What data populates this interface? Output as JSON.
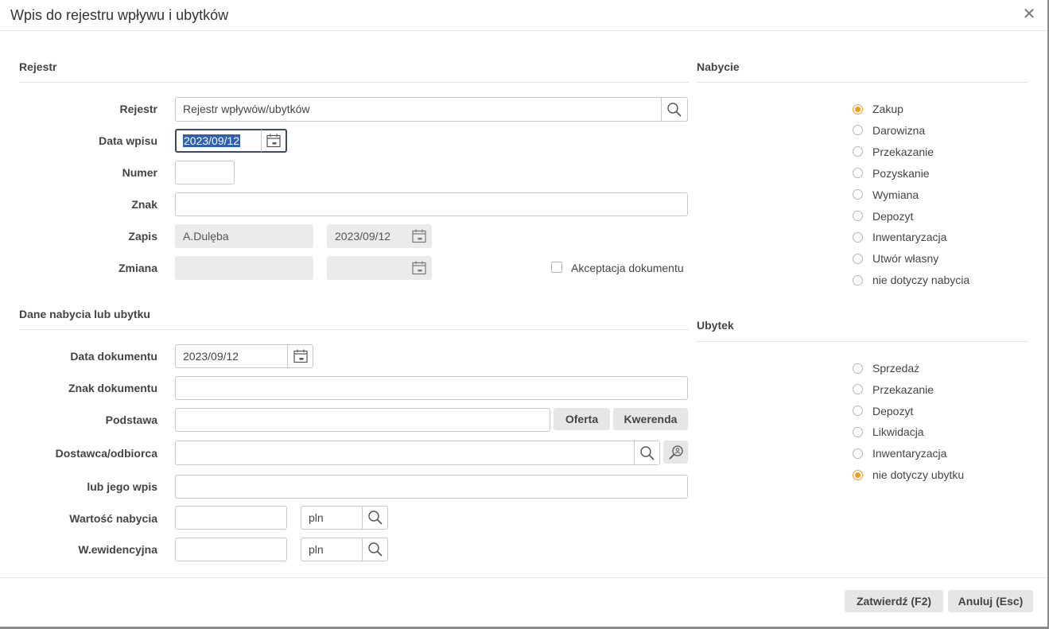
{
  "window": {
    "title": "Wpis do rejestru wpływu i ubytków"
  },
  "rejestr_section": {
    "title": "Rejestr",
    "rejestr_label": "Rejestr",
    "rejestr_value": "Rejestr wpływów/ubytków",
    "data_wpisu_label": "Data wpisu",
    "data_wpisu_value": "2023/09/12",
    "numer_label": "Numer",
    "numer_value": "",
    "znak_label": "Znak",
    "znak_value": "",
    "zapis_label": "Zapis",
    "zapis_user": "A.Dulęba",
    "zapis_date": "2023/09/12",
    "zmiana_label": "Zmiana",
    "zmiana_user": "",
    "zmiana_date": "",
    "akceptacja_label": "Akceptacja dokumentu",
    "akceptacja_checked": false
  },
  "dane_section": {
    "title": "Dane nabycia lub ubytku",
    "data_dokumentu_label": "Data dokumentu",
    "data_dokumentu_value": "2023/09/12",
    "znak_dokumentu_label": "Znak dokumentu",
    "znak_dokumentu_value": "",
    "podstawa_label": "Podstawa",
    "podstawa_value": "",
    "oferta_button": "Oferta",
    "kwerenda_button": "Kwerenda",
    "dostawca_label": "Dostawca/odbiorca",
    "dostawca_value": "",
    "lub_wpis_label": "lub jego wpis",
    "lub_wpis_value": "",
    "wartosc_label": "Wartość nabycia",
    "wartosc_value": "",
    "wartosc_currency": "pln",
    "wewid_label": "W.ewidencyjna",
    "wewid_value": "",
    "wewid_currency": "pln"
  },
  "nabycie": {
    "title": "Nabycie",
    "options": [
      "Zakup",
      "Darowizna",
      "Przekazanie",
      "Pozyskanie",
      "Wymiana",
      "Depozyt",
      "Inwentaryzacja",
      "Utwór własny",
      "nie dotyczy nabycia"
    ],
    "selected": "Zakup"
  },
  "ubytek": {
    "title": "Ubytek",
    "options": [
      "Sprzedaż",
      "Przekazanie",
      "Depozyt",
      "Likwidacja",
      "Inwentaryzacja",
      "nie dotyczy ubytku"
    ],
    "selected": "nie dotyczy ubytku"
  },
  "footer": {
    "confirm_label": "Zatwierdź (F2)",
    "cancel_label": "Anuluj (Esc)"
  },
  "colors": {
    "accent_radio": "#f29b1d",
    "selection": "#2f5fb3"
  },
  "icons": [
    "close-icon",
    "search-icon",
    "calendar-icon",
    "person-search-icon"
  ]
}
